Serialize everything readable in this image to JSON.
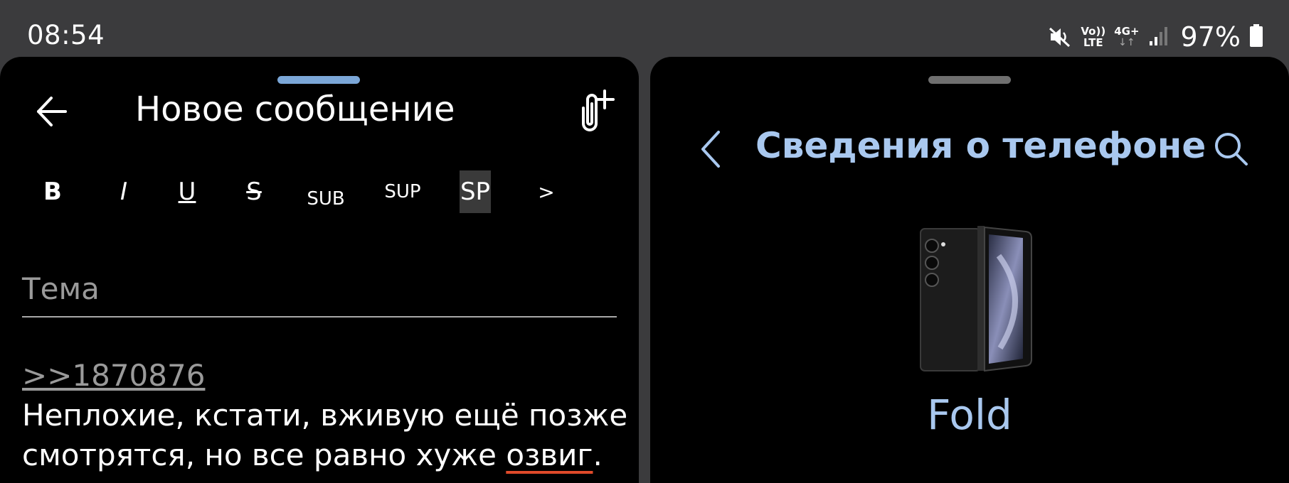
{
  "status_bar": {
    "time": "08:54",
    "volte_top": "Vo))",
    "volte_bottom": "LTE",
    "network_top": "4G+",
    "network_bottom": "↓↑",
    "battery_percent": "97%",
    "icons": [
      "mute-icon",
      "volte-icon",
      "network-icon",
      "signal-icon",
      "battery-icon"
    ]
  },
  "compose": {
    "title": "Новое сообщение",
    "format_buttons": {
      "bold": "B",
      "italic": "I",
      "underline": "U",
      "strike": "S",
      "sub": "SUB",
      "sup": "SUP",
      "spoiler": "SP",
      "more": ">"
    },
    "subject_placeholder": "Тема",
    "reply_link": ">>1870876",
    "body_line1": "Неплохие, кстати, вживую ещё позже",
    "body_line2_prefix": "смотрятся, но все равно хуже ",
    "body_misspelled": "озвиг",
    "body_line2_suffix": ".",
    "accent_color": "#7ba7d8"
  },
  "phone_info": {
    "title": "Сведения о телефоне",
    "model_name": "Fold",
    "accent_color": "#a9c8ef"
  }
}
